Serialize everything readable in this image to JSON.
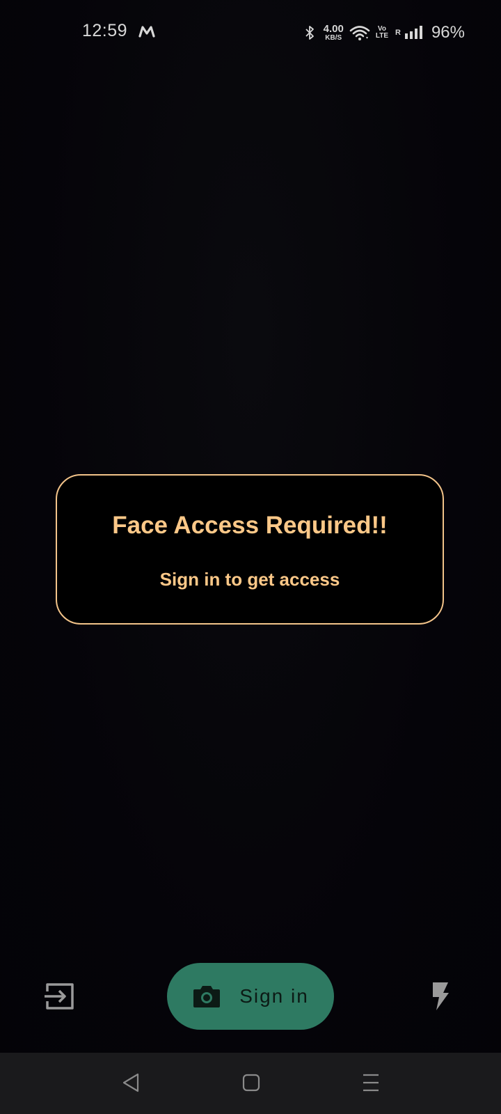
{
  "status_bar": {
    "time": "12:59",
    "carrier_logo": "M",
    "network_speed_value": "4.00",
    "network_speed_unit": "KB/S",
    "volte_top": "Vo",
    "volte_bottom": "LTE",
    "roaming": "R",
    "battery": "96%",
    "icons": [
      "bluetooth-icon",
      "wifi-icon",
      "signal-icon"
    ]
  },
  "dialog": {
    "title": "Face Access Required!!",
    "subtitle": "Sign in to get access"
  },
  "controls": {
    "exit_icon": "exit-icon",
    "signin_label": "Sign in",
    "signin_icon": "camera-icon",
    "flash_icon": "flash-icon"
  },
  "nav": {
    "icons": [
      "back-icon",
      "home-icon",
      "menu-icon"
    ]
  },
  "colors": {
    "accent": "#fcc888",
    "card_border": "#f3c48a",
    "button_bg": "#2e7a62",
    "background": "#050409",
    "nav_bg": "#1a1a1c"
  }
}
